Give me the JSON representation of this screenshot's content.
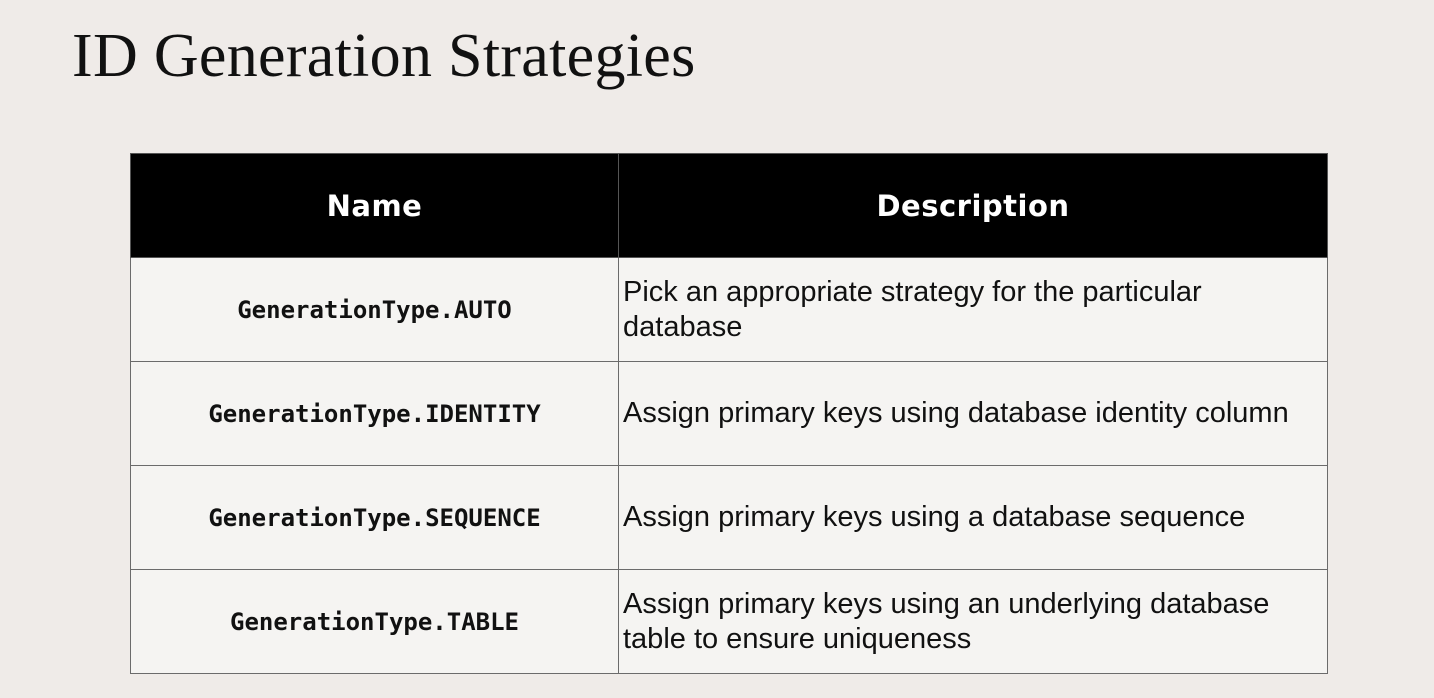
{
  "title": "ID Generation Strategies",
  "table": {
    "headers": [
      "Name",
      "Description"
    ],
    "rows": [
      {
        "name": "GenerationType.AUTO",
        "description": "Pick an appropriate strategy for the particular database"
      },
      {
        "name": "GenerationType.IDENTITY",
        "description": "Assign primary keys using database identity column"
      },
      {
        "name": "GenerationType.SEQUENCE",
        "description": "Assign primary keys using a database sequence"
      },
      {
        "name": "GenerationType.TABLE",
        "description": "Assign primary keys using an underlying database table to ensure uniqueness"
      }
    ]
  },
  "colors": {
    "background": "#efebe8",
    "header_bg": "#000000",
    "header_text": "#ffffff",
    "cell_bg": "#f5f4f2"
  }
}
